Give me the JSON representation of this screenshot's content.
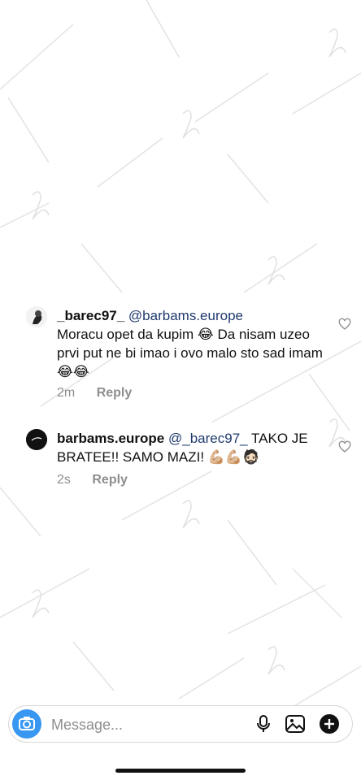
{
  "comments": [
    {
      "username": "_barec97_",
      "mention": "@barbams.europe",
      "text": "Moracu opet da kupim 😂 Da nisam uzeo prvi put ne bi imao i ovo malo sto sad imam 😂😂",
      "time": "2m",
      "reply_label": "Reply"
    },
    {
      "username": "barbams.europe",
      "mention": "@_barec97_",
      "text": "TAKO JE BRATEE!! SAMO MAZI! 💪🏼💪🏼🧔🏻",
      "time": "2s",
      "reply_label": "Reply"
    }
  ],
  "composer": {
    "placeholder": "Message..."
  },
  "icons": [
    "camera-icon",
    "microphone-icon",
    "gallery-icon",
    "plus-icon",
    "heart-icon"
  ],
  "colors": {
    "accent": "#3897f0",
    "mention": "#1f3a6e",
    "meta": "#8e8e8e"
  }
}
